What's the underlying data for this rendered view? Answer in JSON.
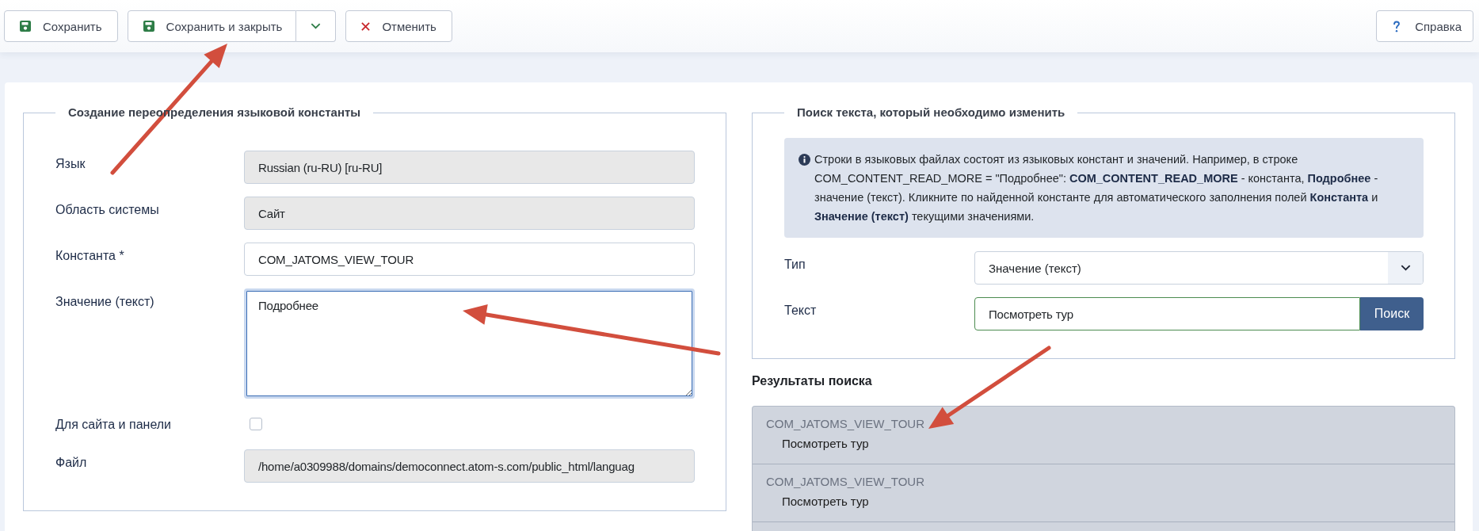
{
  "toolbar": {
    "buttons": [
      {
        "kind": "save",
        "label": "Сохранить"
      },
      {
        "kind": "split",
        "label": "Сохранить и закрыть"
      },
      {
        "kind": "cancel",
        "label": "Отменить"
      }
    ],
    "help": {
      "label": "Справка"
    }
  },
  "override_form": {
    "legend": "Создание переопределения языковой константы",
    "fields": [
      {
        "kind": "text",
        "label": "Язык",
        "value": "Russian (ru-RU) [ru-RU]",
        "disabled": true,
        "focused": false
      },
      {
        "kind": "text",
        "label": "Область системы",
        "value": "Сайт",
        "disabled": true,
        "focused": false
      },
      {
        "kind": "text",
        "label": "Константа *",
        "value": "COM_JATOMS_VIEW_TOUR",
        "disabled": false,
        "focused": false
      },
      {
        "kind": "textarea",
        "label": "Значение (текст)",
        "value": "Подробнее",
        "disabled": false,
        "focused": true
      },
      {
        "kind": "checkbox",
        "label": "Для сайта и панели",
        "checked": false,
        "disabled": false,
        "focused": false
      },
      {
        "kind": "text",
        "label": "Файл",
        "value": "/home/a0309988/domains/democonnect.atom-s.com/public_html/languag",
        "disabled": true,
        "focused": false
      }
    ]
  },
  "search_panel": {
    "legend": "Поиск текста, который необходимо изменить",
    "info": "Строки в языковых файлах состоят из языковых констант и значений. Например, в строке COM_CONTENT_READ_MORE = \"Подробнее\": **COM_CONTENT_READ_MORE** - константа, **Подробнее** - значение (текст). Кликните по найденной константе для автоматического заполнения полей **Константа** и **Значение (текст)** текущими значениями.",
    "type_select": {
      "label": "Тип",
      "value": "Значение (текст)"
    },
    "text_field": {
      "label": "Текст",
      "value": "Посмотреть тур",
      "valid": true
    },
    "search_button": {
      "label": "Поиск"
    }
  },
  "results": {
    "title": "Результаты поиска",
    "items": [
      {
        "constant": "COM_JATOMS_VIEW_TOUR",
        "value": "Посмотреть тур"
      },
      {
        "constant": "COM_JATOMS_VIEW_TOUR",
        "value": "Посмотреть тур"
      }
    ]
  }
}
